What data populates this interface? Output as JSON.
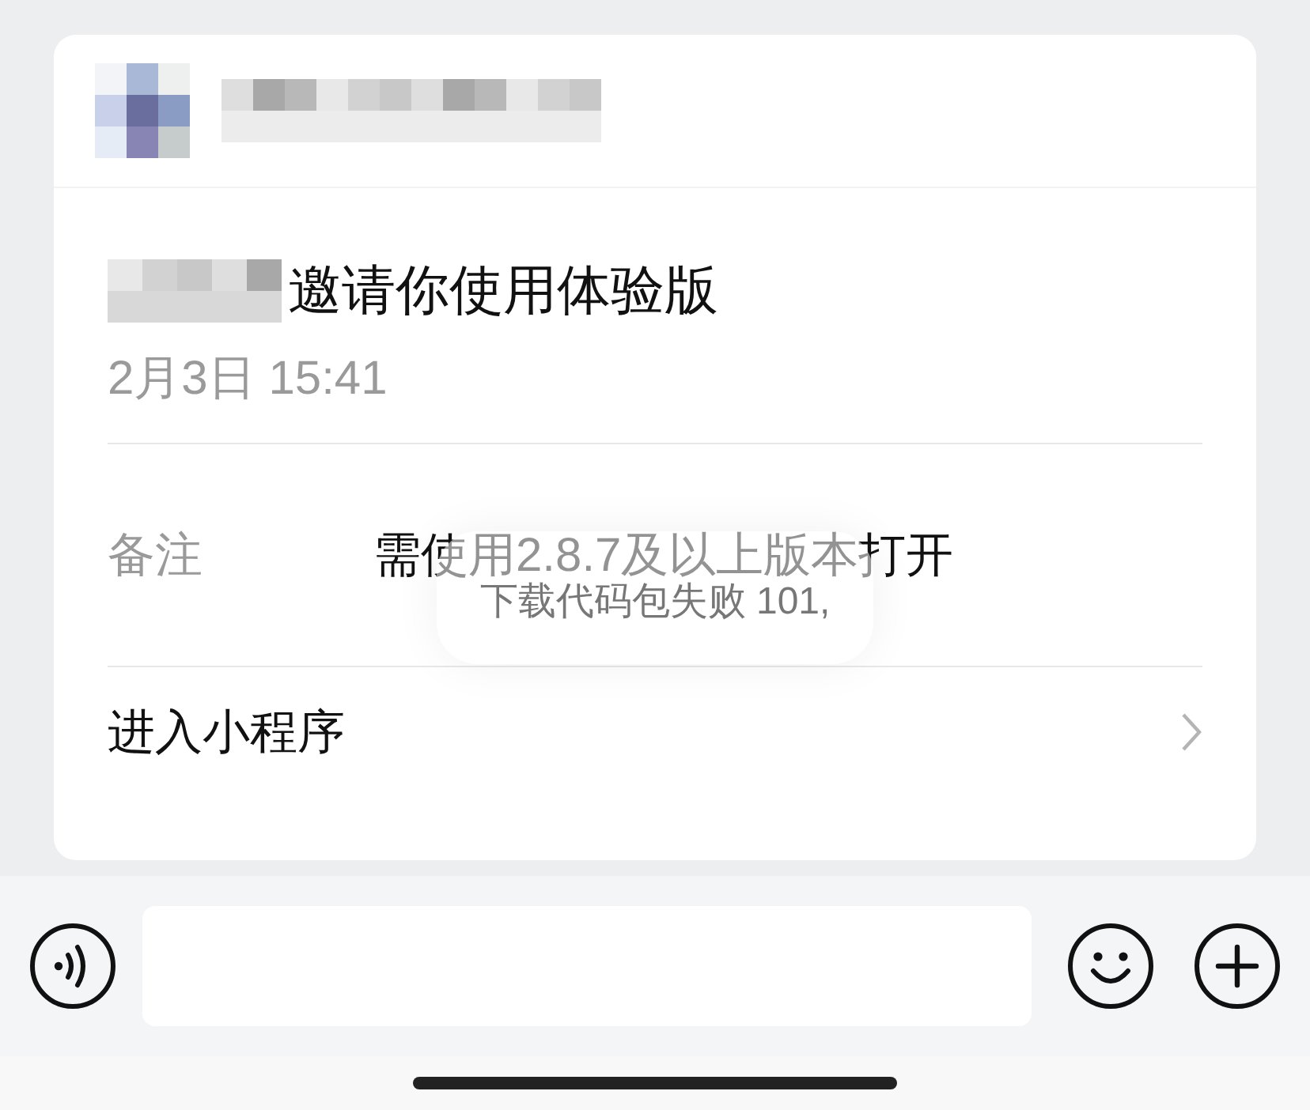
{
  "invite": {
    "title": "邀请你使用体验版",
    "time": "2月3日 15:41"
  },
  "rows": [
    {
      "kind": "note",
      "label": "备注",
      "value": "需使用2.8.7及以上版本打开"
    },
    {
      "kind": "link",
      "label": "进入小程序"
    }
  ],
  "toast": {
    "message": "下载代码包失败 101,"
  }
}
